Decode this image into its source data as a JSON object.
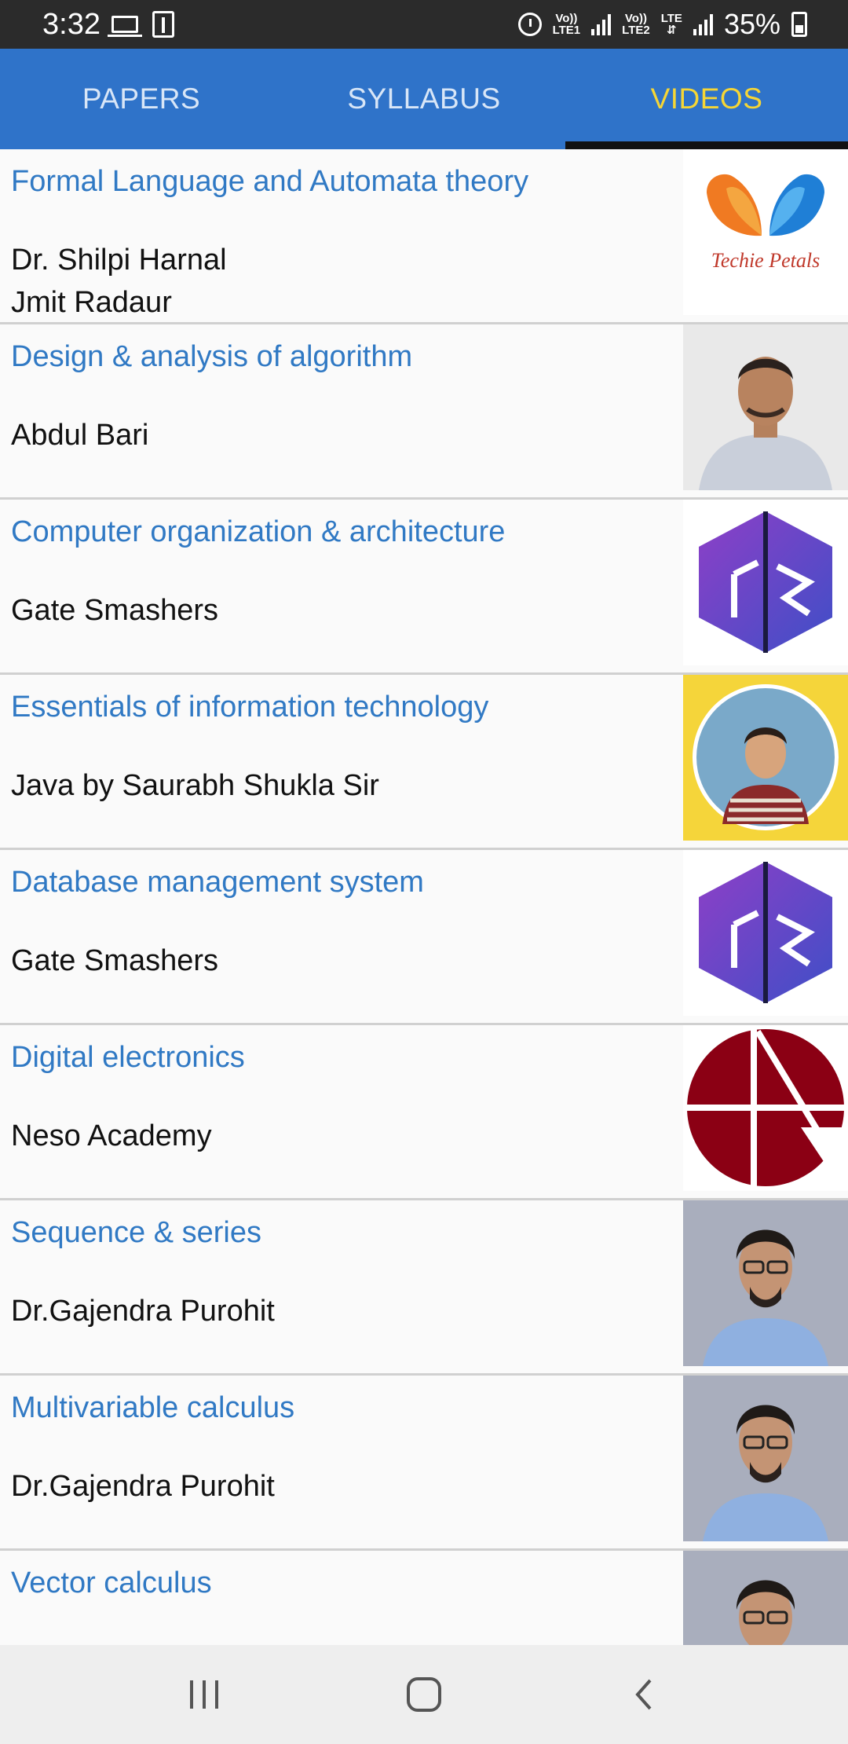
{
  "status_bar": {
    "time": "3:32",
    "sim1_label_top": "Vo))",
    "sim1_label_bottom": "LTE1",
    "sim2_label_top": "Vo))",
    "sim2_label_bottom": "LTE2",
    "data_label": "LTE",
    "battery": "35%",
    "icons": [
      "laptop-icon",
      "usb-icon",
      "alarm-icon",
      "signal-icon",
      "signal-icon",
      "battery-icon"
    ]
  },
  "tabs": [
    {
      "label": "PAPERS",
      "active": false
    },
    {
      "label": "SYLLABUS",
      "active": false
    },
    {
      "label": "VIDEOS",
      "active": true
    }
  ],
  "colors": {
    "tab_bar": "#2f73c9",
    "active_tab_text": "#f6d635",
    "inactive_tab_text": "#d8e6f7",
    "item_title": "#3079c4",
    "item_author": "#111111"
  },
  "videos": [
    {
      "title": "Formal Language and Automata theory",
      "author": "Dr. Shilpi Harnal",
      "author2": "Jmit Radaur",
      "thumbnail": "techie-petals-logo",
      "thumbnail_text": "Techie Petals"
    },
    {
      "title": "Design & analysis of algorithm",
      "author": "Abdul Bari",
      "thumbnail": "presenter-photo"
    },
    {
      "title": "Computer organization & architecture",
      "author": "Gate Smashers",
      "thumbnail": "gate-smashers-logo"
    },
    {
      "title": "Essentials of information technology",
      "author": "Java by Saurabh Shukla Sir",
      "thumbnail": "presenter-photo-circle"
    },
    {
      "title": "Database management system",
      "author": "Gate Smashers",
      "thumbnail": "gate-smashers-logo"
    },
    {
      "title": "Digital electronics",
      "author": "Neso Academy",
      "thumbnail": "neso-academy-logo"
    },
    {
      "title": "Sequence & series",
      "author": "Dr.Gajendra Purohit",
      "thumbnail": "presenter-photo"
    },
    {
      "title": "Multivariable calculus",
      "author": "Dr.Gajendra Purohit",
      "thumbnail": "presenter-photo"
    },
    {
      "title": "Vector calculus",
      "author": "",
      "thumbnail": "presenter-photo"
    }
  ],
  "nav_bar": {
    "icons": [
      "recent-apps-icon",
      "home-icon",
      "back-icon"
    ]
  }
}
